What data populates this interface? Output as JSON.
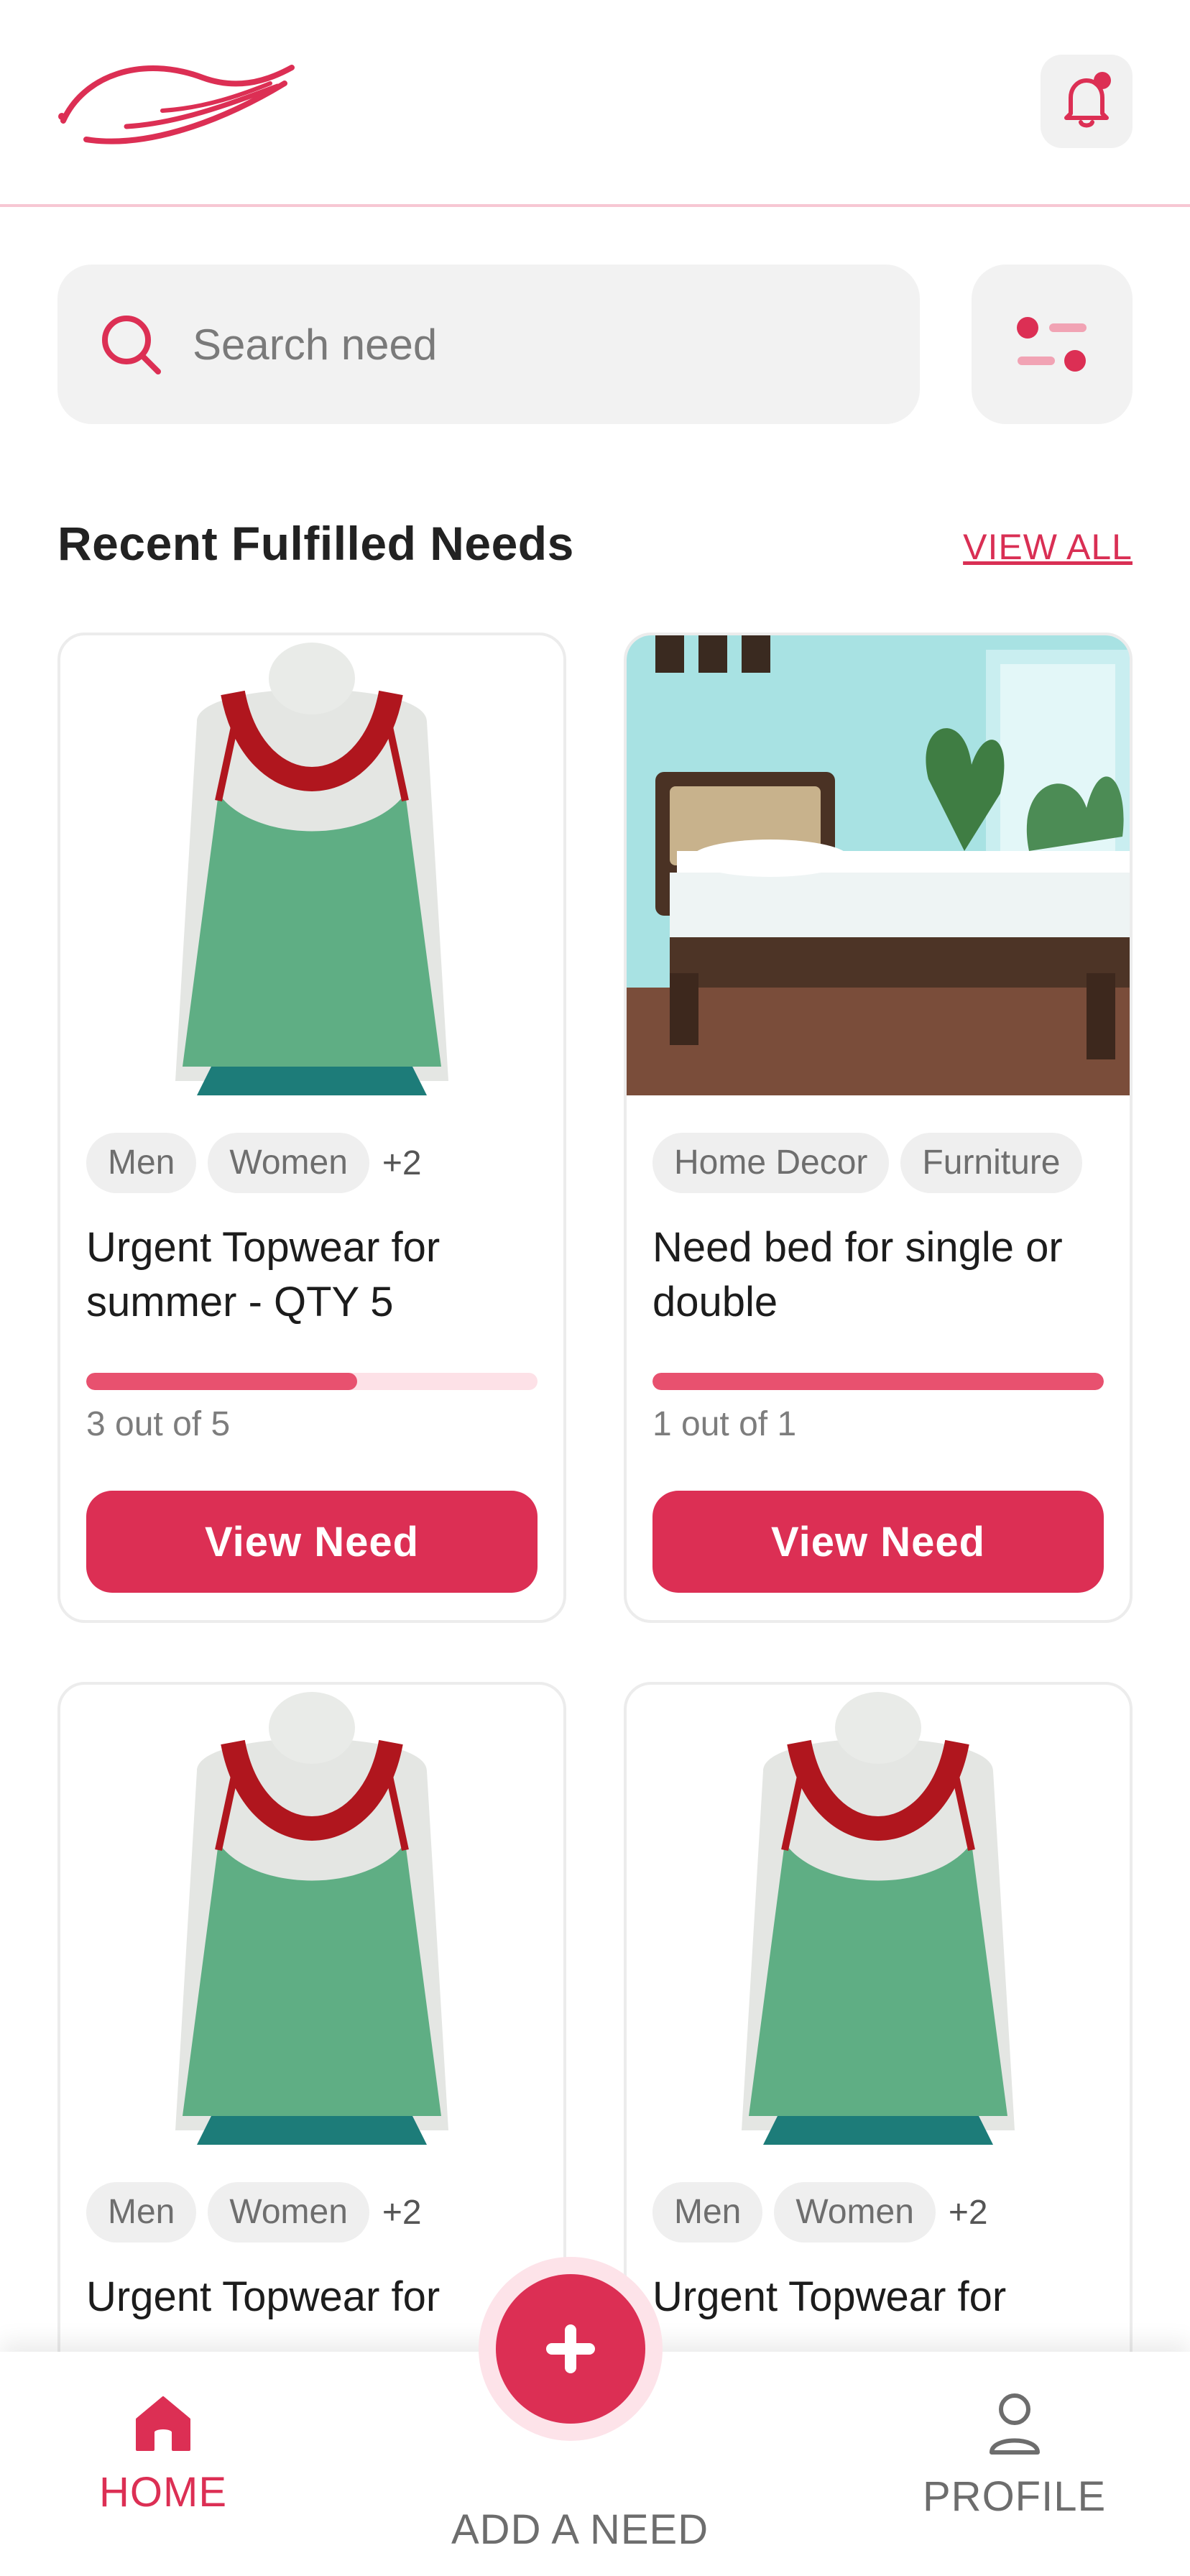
{
  "header": {
    "logo_icon": "wing-logo",
    "notification_icon": "bell-icon",
    "has_notification_dot": true
  },
  "search": {
    "placeholder": "Search need",
    "icon": "search-icon",
    "filter_icon": "filter-icon"
  },
  "section": {
    "title": "Recent Fulfilled Needs",
    "view_all": "VIEW ALL"
  },
  "cards": [
    {
      "image": "green-tank-top-on-mannequin",
      "tags": [
        "Men",
        "Women"
      ],
      "more": "+2",
      "title": "Urgent Topwear for summer - QTY 5",
      "progress_fraction": 0.6,
      "progress_text": "3 out of 5",
      "button": "View Need"
    },
    {
      "image": "single-bed-in-room",
      "tags": [
        "Home Decor",
        "Furniture"
      ],
      "more": "",
      "title": "Need bed for single or double",
      "progress_fraction": 1.0,
      "progress_text": "1 out of 1",
      "button": "View Need"
    },
    {
      "image": "green-tank-top-on-mannequin",
      "tags": [
        "Men",
        "Women"
      ],
      "more": "+2",
      "title": "Urgent Topwear for"
    },
    {
      "image": "green-tank-top-on-mannequin",
      "tags": [
        "Men",
        "Women"
      ],
      "more": "+2",
      "title": "Urgent Topwear for"
    }
  ],
  "nav": {
    "home": "HOME",
    "add": "ADD A NEED",
    "profile": "PROFILE",
    "home_icon": "home-icon",
    "add_icon": "plus-icon",
    "profile_icon": "user-icon"
  },
  "colors": {
    "accent": "#dc2f54",
    "progress_track": "#fde1e7",
    "progress_fill": "#e8516f",
    "chip_bg": "#efefef"
  }
}
